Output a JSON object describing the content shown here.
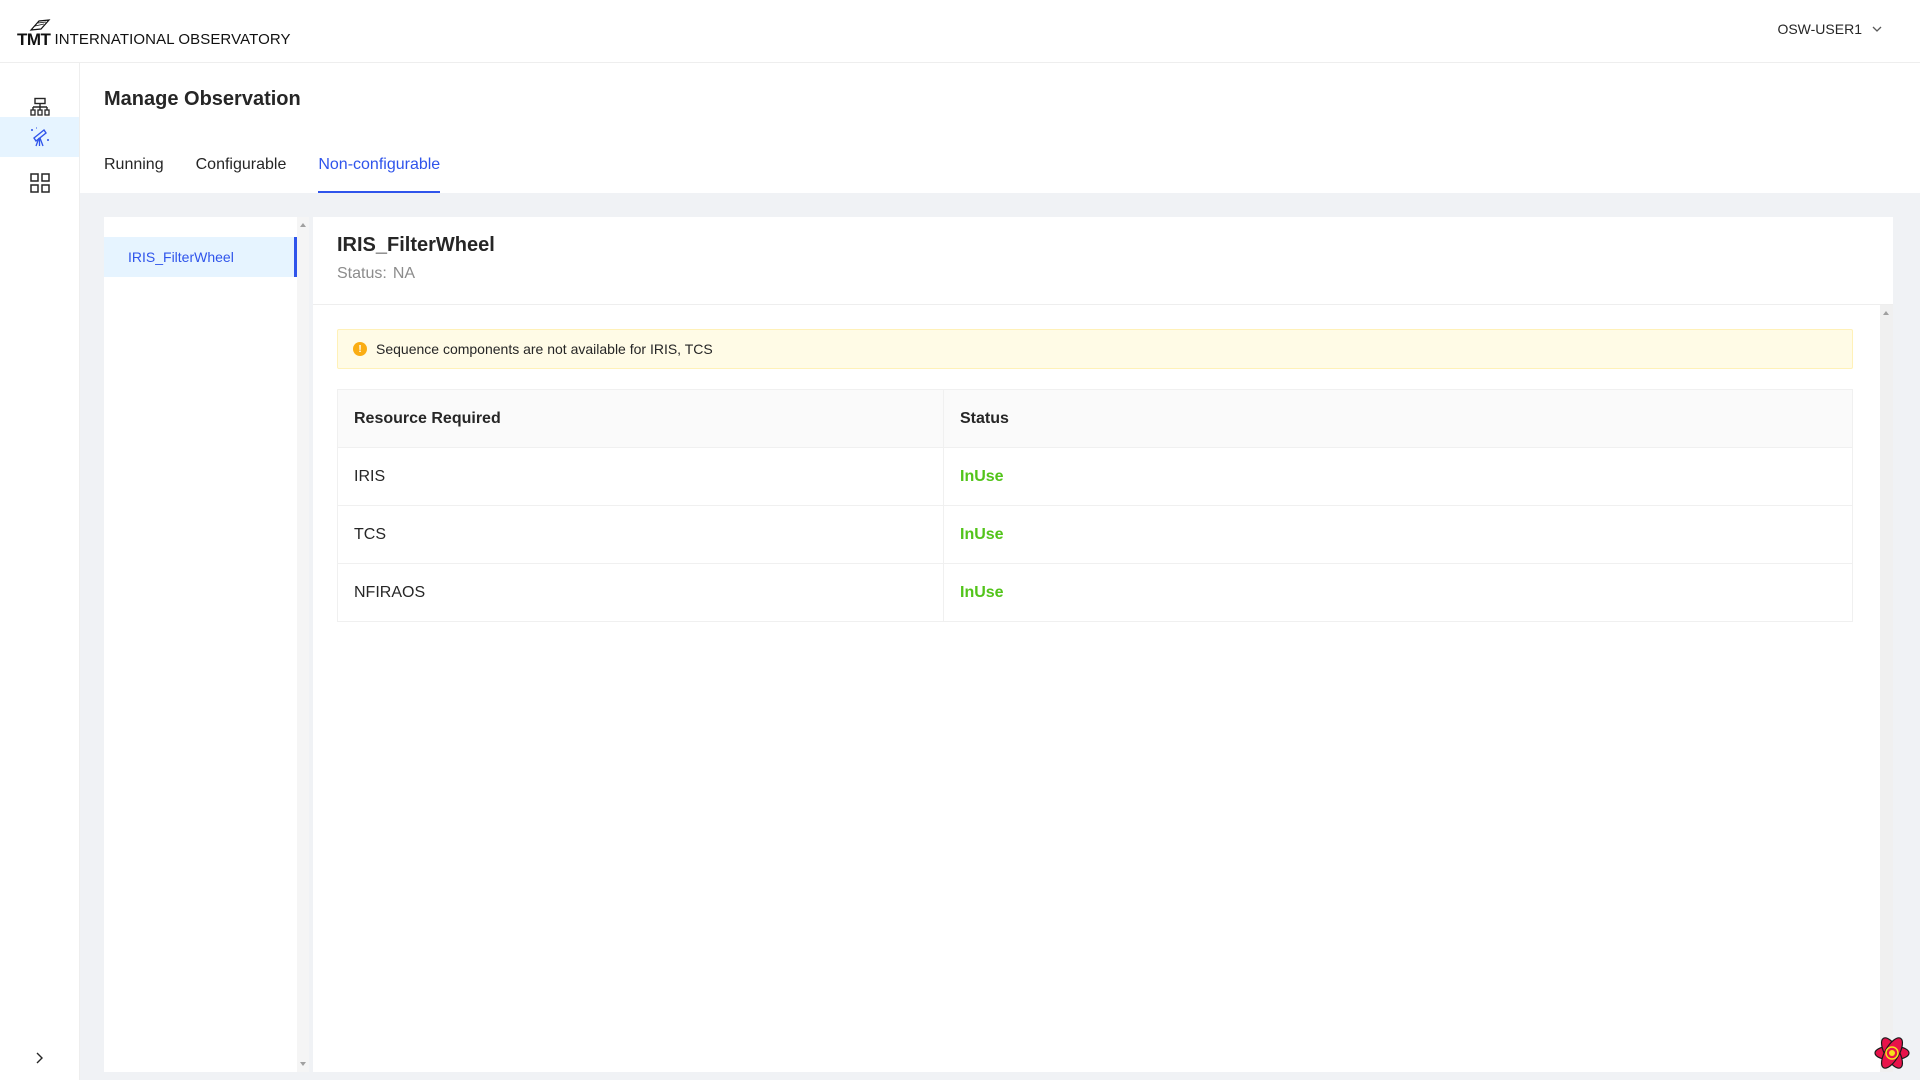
{
  "header": {
    "logo_mark": "TMT",
    "logo_text": "INTERNATIONAL OBSERVATORY",
    "user": "OSW-USER1"
  },
  "sidebar": {
    "items": [
      {
        "icon": "hierarchy-icon",
        "active": false
      },
      {
        "icon": "telescope-icon",
        "active": true
      },
      {
        "icon": "grid-icon",
        "active": false
      }
    ],
    "collapse_icon": "chevron-right-icon"
  },
  "page": {
    "title": "Manage Observation",
    "tabs": [
      {
        "label": "Running",
        "active": false
      },
      {
        "label": "Configurable",
        "active": false
      },
      {
        "label": "Non-configurable",
        "active": true
      }
    ]
  },
  "list": {
    "items": [
      {
        "label": "IRIS_FilterWheel",
        "selected": true
      }
    ]
  },
  "detail": {
    "title": "IRIS_FilterWheel",
    "status_label": "Status:",
    "status_value": "NA",
    "alert": "Sequence components are not available for IRIS, TCS",
    "table": {
      "headers": [
        "Resource Required",
        "Status"
      ],
      "rows": [
        {
          "resource": "IRIS",
          "status": "InUse"
        },
        {
          "resource": "TCS",
          "status": "InUse"
        },
        {
          "resource": "NFIRAOS",
          "status": "InUse"
        }
      ]
    }
  },
  "colors": {
    "accent": "#2f54eb",
    "status_inuse": "#52c41a",
    "alert_bg": "#fffbe6",
    "warning": "#faad14"
  }
}
